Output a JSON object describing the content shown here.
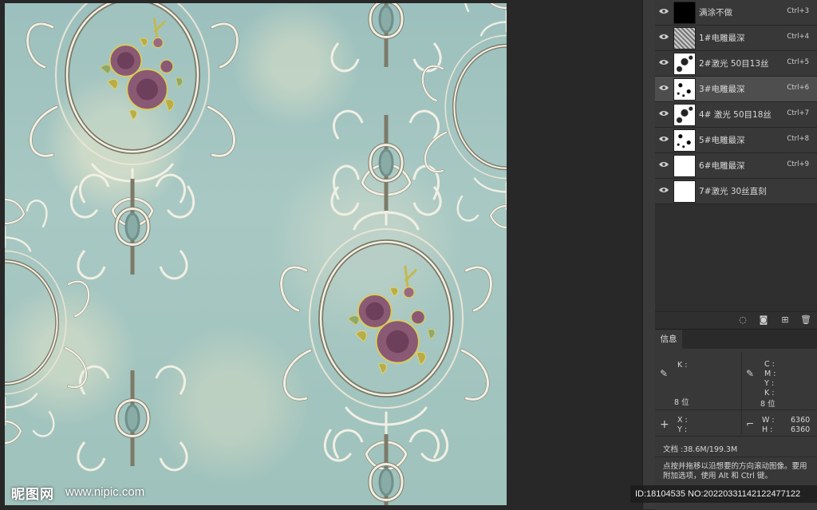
{
  "layers": [
    {
      "name": "满涂不做",
      "shortcut": "Ctrl+3",
      "thumb": "black",
      "selected": false
    },
    {
      "name": "1#电雕最深",
      "shortcut": "Ctrl+4",
      "thumb": "gray",
      "selected": false
    },
    {
      "name": "2#激光 50目13丝",
      "shortcut": "Ctrl+5",
      "thumb": "speckle2",
      "selected": false
    },
    {
      "name": "3#电雕最深",
      "shortcut": "Ctrl+6",
      "thumb": "speckle",
      "selected": true
    },
    {
      "name": "4# 激光 50目18丝",
      "shortcut": "Ctrl+7",
      "thumb": "speckle2",
      "selected": false
    },
    {
      "name": "5#电雕最深",
      "shortcut": "Ctrl+8",
      "thumb": "speckle",
      "selected": false
    },
    {
      "name": "6#电雕最深",
      "shortcut": "Ctrl+9",
      "thumb": "white",
      "selected": false
    },
    {
      "name": "7#激光 30丝直刻",
      "shortcut": "",
      "thumb": "white",
      "selected": false
    }
  ],
  "info": {
    "tab_label": "信息",
    "k_label": "K :",
    "c_label": "C :",
    "m_label": "M :",
    "y_label": "Y :",
    "k2_label": "K :",
    "bit_left": "8 位",
    "bit_right": "8 位",
    "x_label": "X :",
    "y_coord_label": "Y :",
    "w_label": "W :",
    "h_label": "H :",
    "w_value": "6360",
    "h_value": "6360",
    "doc_size": "文档 :38.6M/199.3M",
    "hint": "点按并拖移以沿想要的方向滚动图像。要用附加选项，使用 Alt 和 Ctrl 键。"
  },
  "watermark": {
    "logo": "昵图网",
    "url": "www.nipic.com",
    "id_text": "ID:18104535 NO:20220331142122477122"
  },
  "icons": {
    "visibility": "eye-icon",
    "eyedropper": "eyedropper-icon",
    "crosshair": "crosshair-icon",
    "selection": "selection-size-icon",
    "new_fill": "fill-layer-icon",
    "mask": "mask-icon",
    "new_layer": "new-layer-icon",
    "trash": "trash-icon"
  },
  "colors": {
    "panel_bg": "#383838",
    "selected_row": "#4e4e4e",
    "wallpaper_teal": "#9fc2bc",
    "flower_purple": "#7a4a66",
    "flower_gold": "#d6c75a"
  }
}
